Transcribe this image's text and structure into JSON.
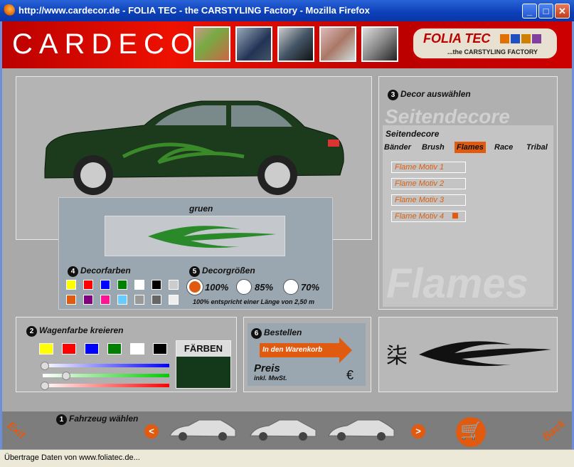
{
  "window": {
    "title": "http://www.cardecor.de - FOLIA TEC - the CARSTYLING Factory - Mozilla Firefox",
    "minimize": "_",
    "maximize": "□",
    "close": "✕"
  },
  "header": {
    "logo": "CARDECOR",
    "brand": "FOLIA TEC",
    "tagline": "...the CARSTYLING FACTORY"
  },
  "preview": {
    "color_name": "gruen",
    "decor_colors_label": "Decorfarben",
    "decor_colors_num": "4",
    "decor_sizes_label": "Decorgrößen",
    "decor_sizes_num": "5",
    "sizes": [
      "100%",
      "85%",
      "70%"
    ],
    "size_note": "100% entspricht einer Länge von 2,50 m",
    "colors": [
      "#ffff00",
      "#ff0000",
      "#0000ff",
      "#008000",
      "#ffffff",
      "#000000",
      "#cccccc",
      "#e05a10",
      "#800080",
      "#ff1493",
      "#66ccff",
      "#999999",
      "#666666",
      "#eeeeee"
    ]
  },
  "decor": {
    "num": "3",
    "label": "Decor auswählen",
    "watermark": "Seitendecore",
    "section": "Seitendecore",
    "tabs": [
      "Bänder",
      "Brush",
      "Flames",
      "Race",
      "Tribal"
    ],
    "active_tab": "Flames",
    "motifs": [
      "Flame Motiv 1",
      "Flame Motiv 2",
      "Flame Motiv 3",
      "Flame Motiv 4"
    ],
    "big_text": "Flames"
  },
  "wagen": {
    "num": "2",
    "label": "Wagenfarbe kreieren",
    "farben_label": "FÄRBEN",
    "colors": [
      "#ffff00",
      "#ff0000",
      "#0000ff",
      "#008000",
      "#ffffff",
      "#000000"
    ]
  },
  "order": {
    "num": "6",
    "label": "Bestellen",
    "cart_button": "In den Warenkorb",
    "price_label": "Preis",
    "price_note": "inkl. MwSt.",
    "currency": "€"
  },
  "footer": {
    "num": "1",
    "label": "Fahrzeug wählen",
    "exit": "Exit",
    "back": "Back",
    "prev": "<",
    "next": ">"
  },
  "status": {
    "text": "Übertrage Daten von www.foliatec.de..."
  }
}
